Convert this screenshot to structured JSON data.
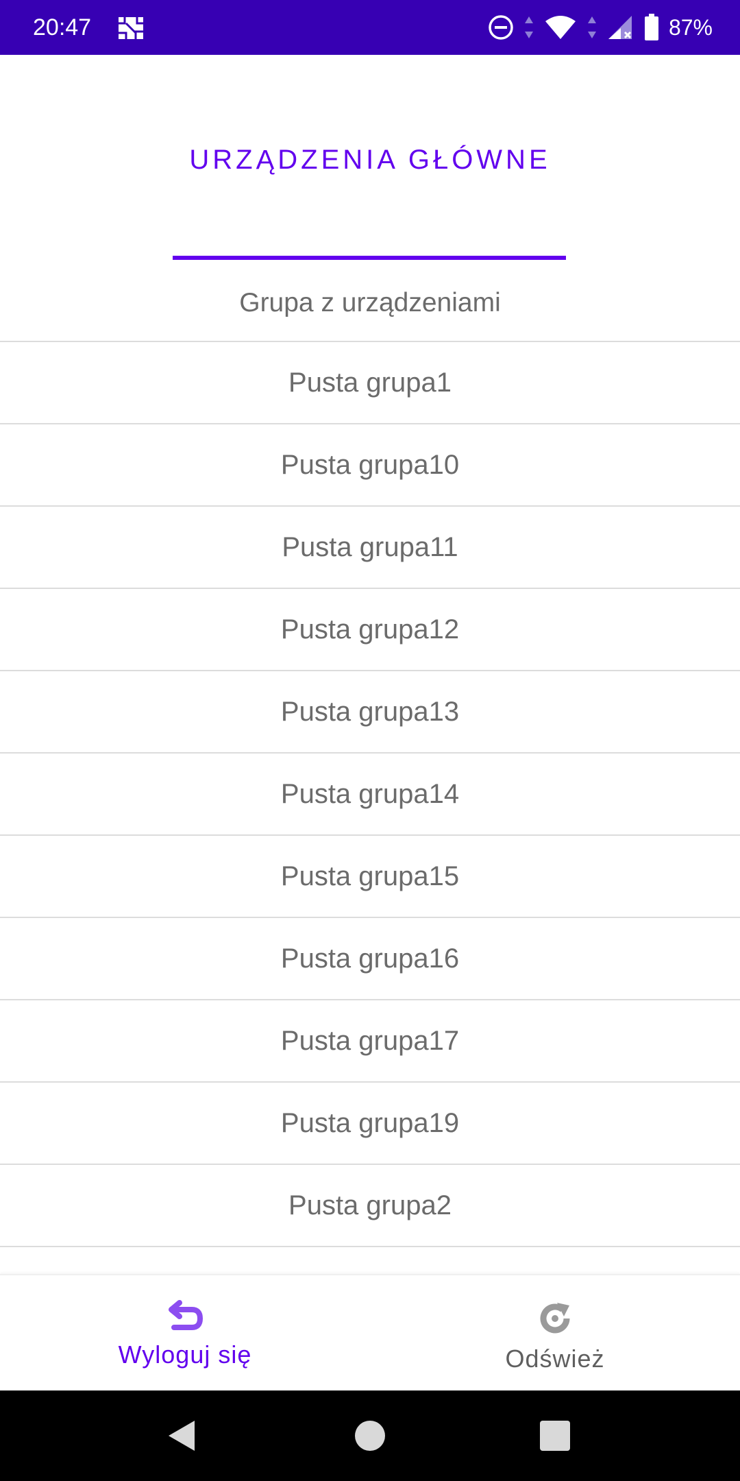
{
  "status_bar": {
    "time": "20:47",
    "battery_percent": "87%",
    "background_color": "#3700b3",
    "icons": [
      "app-notification-icon",
      "do-not-disturb-icon",
      "wifi-icon",
      "signal-icon",
      "battery-icon"
    ]
  },
  "header": {
    "title": "URZĄDZENIA GŁÓWNE",
    "accent_color": "#6200ee"
  },
  "list": {
    "header": "Grupa z urządzeniami",
    "items": [
      "Pusta grupa1",
      "Pusta grupa10",
      "Pusta grupa11",
      "Pusta grupa12",
      "Pusta grupa13",
      "Pusta grupa14",
      "Pusta grupa15",
      "Pusta grupa16",
      "Pusta grupa17",
      "Pusta grupa19",
      "Pusta grupa2",
      ""
    ]
  },
  "bottom_nav": {
    "logout": {
      "label": "Wyloguj się",
      "icon": "undo-arrow-icon",
      "active": true
    },
    "refresh": {
      "label": "Odśwież",
      "icon": "refresh-icon",
      "active": false
    }
  },
  "system_nav": {
    "icons": [
      "back-icon",
      "home-icon",
      "recents-icon"
    ]
  }
}
